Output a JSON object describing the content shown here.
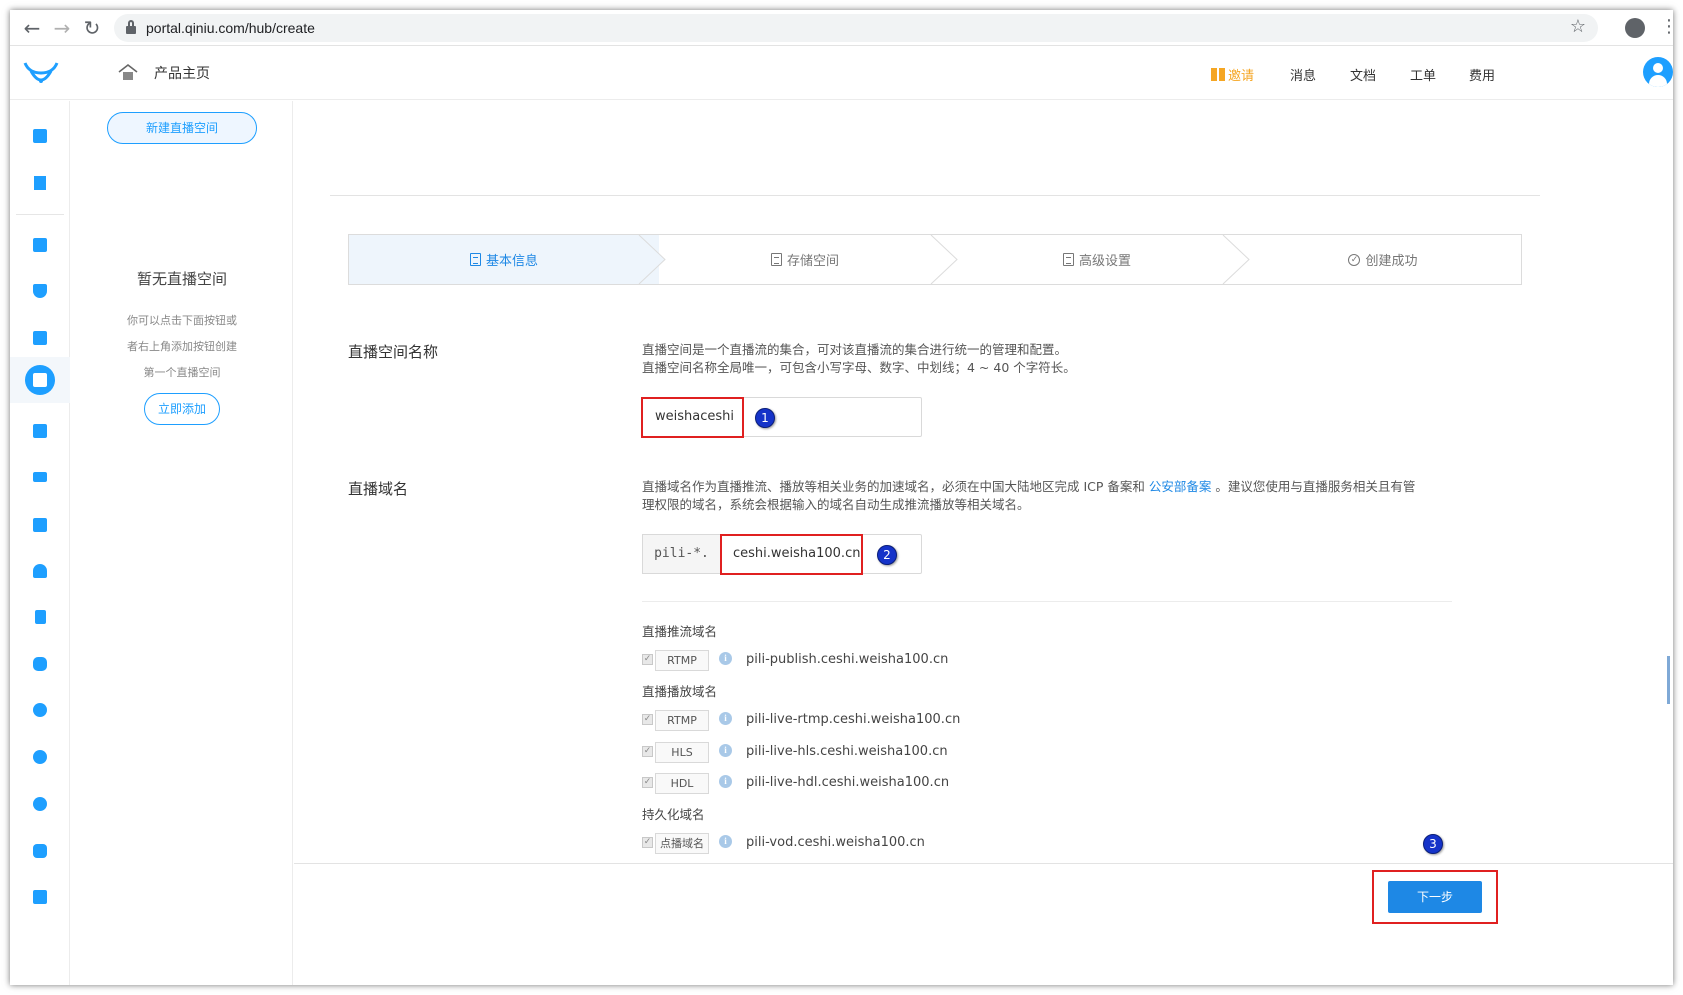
{
  "browser": {
    "url": "portal.qiniu.com/hub/create",
    "back_icon": "arrow-left-icon",
    "forward_icon": "arrow-right-icon",
    "reload_icon": "reload-icon"
  },
  "header": {
    "home_label": "产品主页",
    "invite_label": "邀请",
    "messages_label": "消息",
    "docs_label": "文档",
    "tickets_label": "工单",
    "billing_label": "费用"
  },
  "sidebar": {
    "new_space_label": "新建直播空间",
    "empty_title": "暂无直播空间",
    "empty_lines": [
      "你可以点击下面按钮或",
      "者右上角添加按钮创建",
      "第一个直播空间"
    ],
    "add_now_label": "立即添加"
  },
  "steps": [
    {
      "label": "基本信息",
      "icon": "document-icon",
      "active": true
    },
    {
      "label": "存储空间",
      "icon": "document-icon",
      "active": false
    },
    {
      "label": "高级设置",
      "icon": "document-icon",
      "active": false
    },
    {
      "label": "创建成功",
      "icon": "check-circle-icon",
      "active": false
    }
  ],
  "form": {
    "space_name_label": "直播空间名称",
    "space_name_hint_1": "直播空间是一个直播流的集合，可对该直播流的集合进行统一的管理和配置。",
    "space_name_hint_2": "直播空间名称全局唯一，可包含小写字母、数字、中划线；4 ~ 40 个字符长。",
    "space_name_value": "weishaceshi",
    "domain_label": "直播域名",
    "domain_hint_1a": "直播域名作为直播推流、播放等相关业务的加速域名，必须在中国大陆地区完成 ICP 备案和 ",
    "domain_hint_link": "公安部备案",
    "domain_hint_1b": " 。建议您使用与直播服务相关且有管",
    "domain_hint_2": "理权限的域名，系统会根据输入的域名自动生成推流播放等相关域名。",
    "domain_prefix": "pili-*.",
    "domain_value": "ceshi.weisha100.cn",
    "push_section_label": "直播推流域名",
    "play_section_label": "直播播放域名",
    "persist_section_label": "持久化域名",
    "push_domains": [
      {
        "proto": "RTMP",
        "value": "pili-publish.ceshi.weisha100.cn"
      }
    ],
    "play_domains": [
      {
        "proto": "RTMP",
        "value": "pili-live-rtmp.ceshi.weisha100.cn"
      },
      {
        "proto": "HLS",
        "value": "pili-live-hls.ceshi.weisha100.cn"
      },
      {
        "proto": "HDL",
        "value": "pili-live-hdl.ceshi.weisha100.cn"
      }
    ],
    "persist_domains": [
      {
        "proto": "点播域名",
        "value": "pili-vod.ceshi.weisha100.cn"
      }
    ]
  },
  "annotations": [
    "1",
    "2",
    "3"
  ],
  "next_label": "下一步",
  "colors": {
    "accent": "#1e88e5",
    "highlight": "#e02020",
    "badge": "#1533c9",
    "invite": "#f5a623"
  }
}
